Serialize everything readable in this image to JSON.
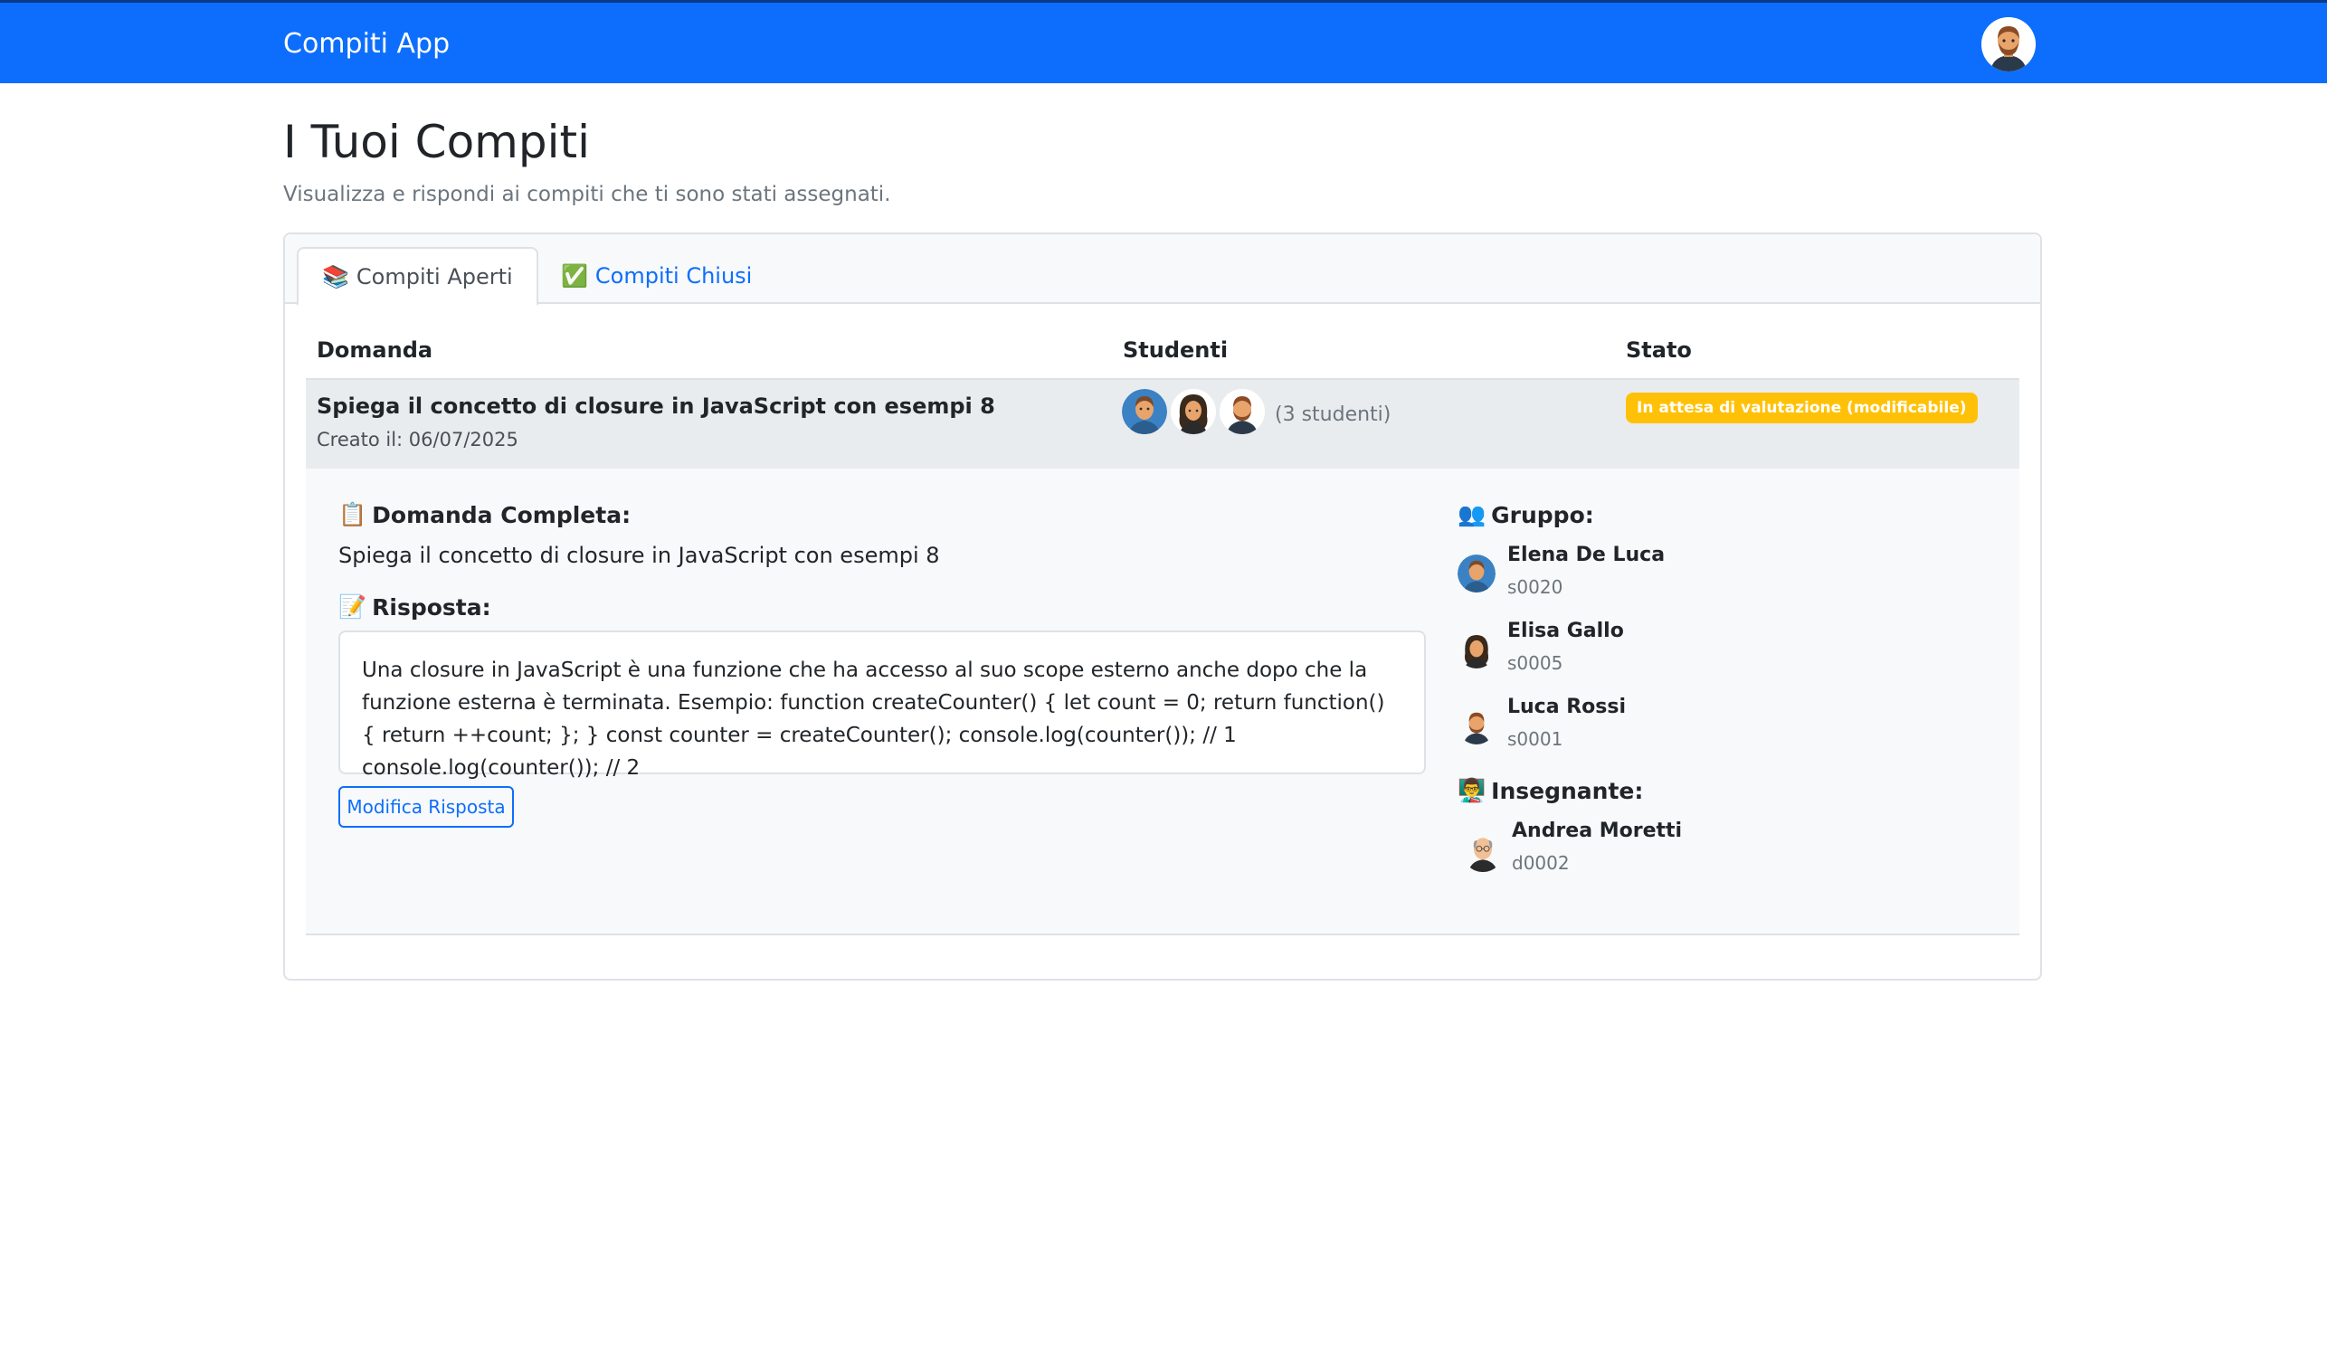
{
  "navbar": {
    "brand": "Compiti App",
    "avatar_icon": "user-avatar-icon"
  },
  "header": {
    "title": "I Tuoi Compiti",
    "subtitle": "Visualizza e rispondi ai compiti che ti sono stati assegnati."
  },
  "tabs": [
    {
      "emoji": "📚",
      "label": "Compiti Aperti",
      "active": true
    },
    {
      "emoji": "✅",
      "label": "Compiti Chiusi",
      "active": false
    }
  ],
  "table": {
    "headers": [
      "Domanda",
      "Studenti",
      "Stato"
    ],
    "row": {
      "question": "Spiega il concetto di closure in JavaScript con esempi 8",
      "created": "Creato il: 06/07/2025",
      "students_count": "(3 studenti)",
      "status": "In attesa di valutazione (modificabile)"
    }
  },
  "details": {
    "full_question_emoji": "📋",
    "full_question_label": "Domanda Completa:",
    "full_question_text": "Spiega il concetto di closure in JavaScript con esempi 8",
    "answer_emoji": "📝",
    "answer_label": "Risposta:",
    "answer_text": "Una closure in JavaScript è una funzione che ha accesso al suo scope esterno anche dopo che la funzione esterna è terminata. Esempio: function createCounter() { let count = 0; return function() { return ++count; }; } const counter = createCounter(); console.log(counter()); // 1 console.log(counter()); // 2",
    "edit_button": "Modifica Risposta",
    "group_emoji": "👥",
    "group_label": "Gruppo:",
    "members": [
      {
        "name": "Elena De Luca",
        "id": "s0020"
      },
      {
        "name": "Elisa Gallo",
        "id": "s0005"
      },
      {
        "name": "Luca Rossi",
        "id": "s0001"
      }
    ],
    "teacher_emoji": "👨‍🏫",
    "teacher_label": "Insegnante:",
    "teacher": {
      "name": "Andrea Moretti",
      "id": "d0002"
    }
  },
  "colors": {
    "primary": "#0d6efd",
    "warning": "#ffc107",
    "muted": "#6c757d"
  }
}
